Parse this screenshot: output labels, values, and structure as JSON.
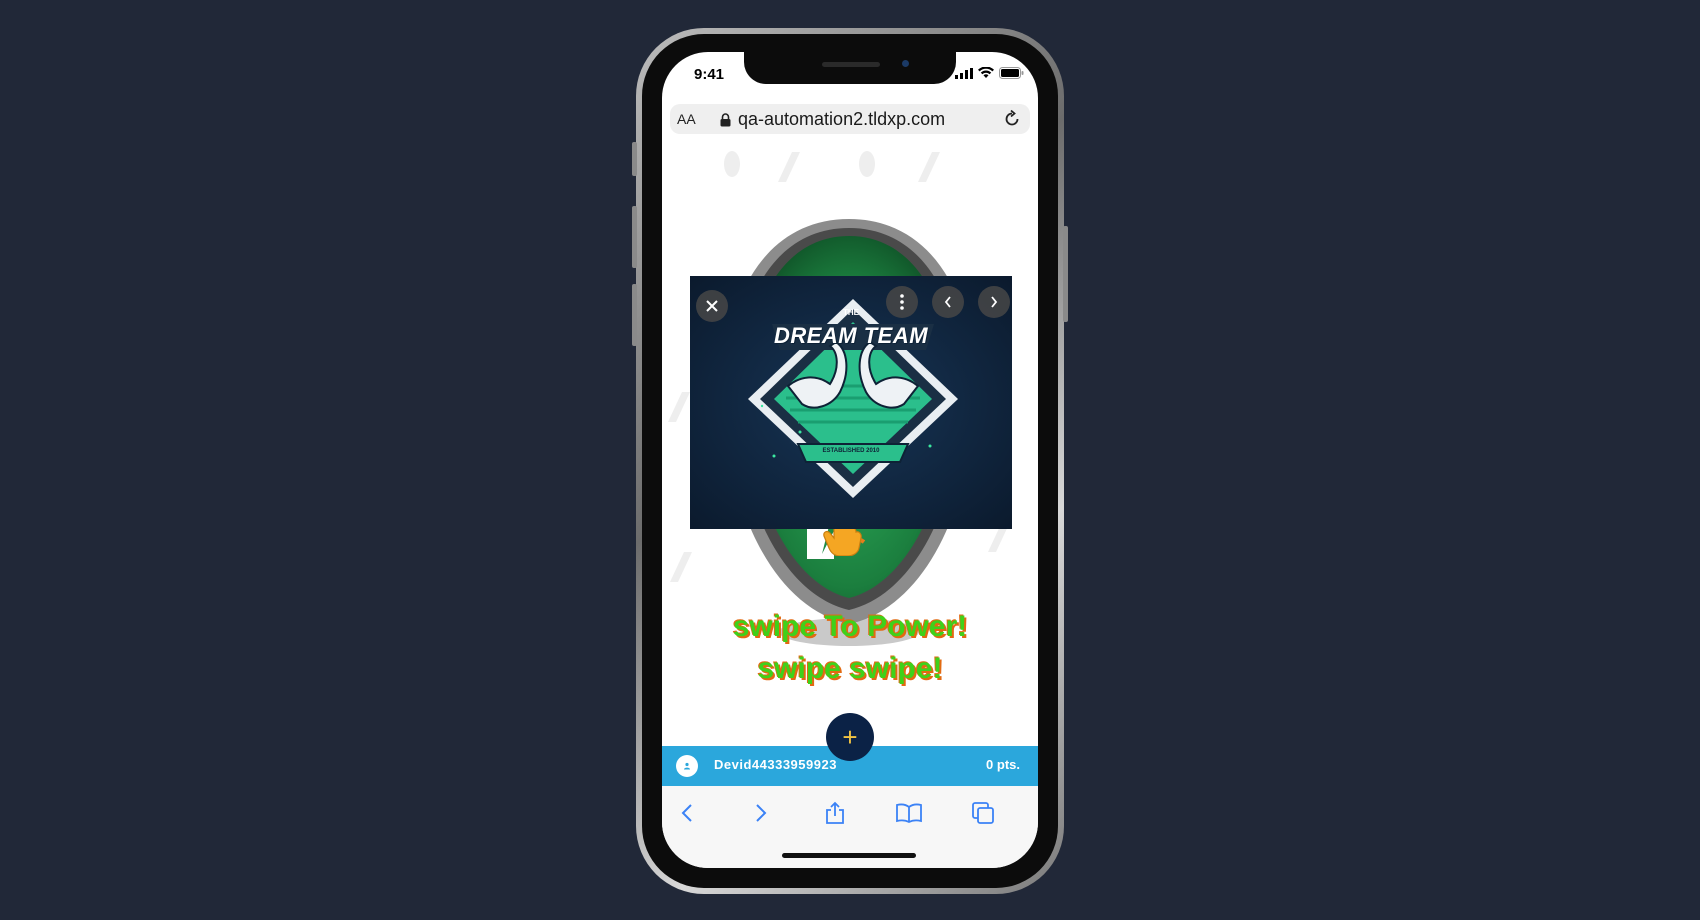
{
  "status_bar": {
    "time": "9:41"
  },
  "browser": {
    "text_size_label": "AA",
    "url": "qa-automation2.tldxp.com"
  },
  "popup": {
    "logo_title_small": "THE",
    "logo_title": "DREAM TEAM",
    "logo_ribbon": "ESTABLISHED 2010"
  },
  "main": {
    "swipe_line1": "swipe To Power!",
    "swipe_line2": "swipe swipe!",
    "fab_label": "+"
  },
  "user_bar": {
    "username": "Devid44333959923",
    "points": "0 pts."
  },
  "colors": {
    "background": "#212838",
    "accent_blue": "#2ba7dc",
    "fab_navy": "#0b2246",
    "swipe_green": "#3fd11a",
    "shield_green": "#1f8a45"
  },
  "icons": [
    "lock-icon",
    "reload-icon",
    "close-icon",
    "more-icon",
    "chevron-left-icon",
    "chevron-right-icon",
    "user-icon",
    "back-icon",
    "forward-icon",
    "share-icon",
    "bookmarks-icon",
    "tabs-icon",
    "pointer-hand-icon"
  ]
}
